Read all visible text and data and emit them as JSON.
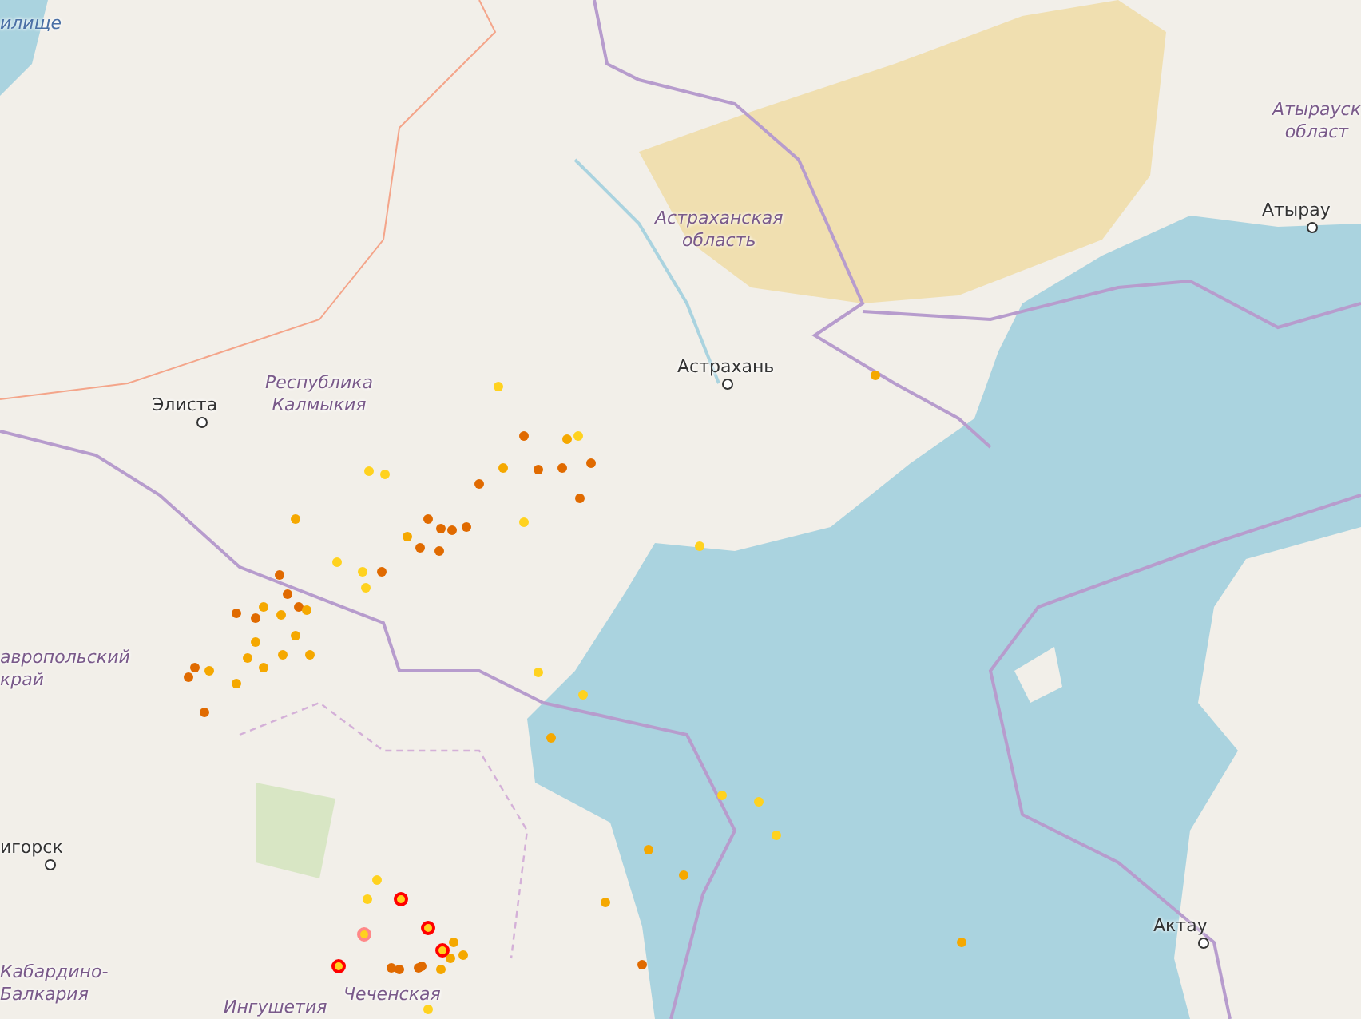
{
  "map": {
    "labels": [
      {
        "kind": "water",
        "lines": [
          "илище"
        ]
      },
      {
        "kind": "region",
        "lines": [
          "Атырауск",
          "област"
        ]
      },
      {
        "kind": "city",
        "lines": [
          "Атырау"
        ]
      },
      {
        "kind": "region",
        "lines": [
          "Астраханская",
          "область"
        ]
      },
      {
        "kind": "city",
        "lines": [
          "Астрахань"
        ]
      },
      {
        "kind": "city",
        "lines": [
          "Элиста"
        ]
      },
      {
        "kind": "region",
        "lines": [
          "Республика",
          "Калмыкия"
        ]
      },
      {
        "kind": "region",
        "lines": [
          "авропольский",
          "край"
        ]
      },
      {
        "kind": "city",
        "lines": [
          "игорск"
        ]
      },
      {
        "kind": "region",
        "lines": [
          "Кабардино-",
          "Балкария"
        ]
      },
      {
        "kind": "region",
        "lines": [
          "Ингушетия"
        ]
      },
      {
        "kind": "region",
        "lines": [
          "Чеченская"
        ]
      },
      {
        "kind": "city",
        "lines": [
          "Актау"
        ]
      }
    ]
  }
}
